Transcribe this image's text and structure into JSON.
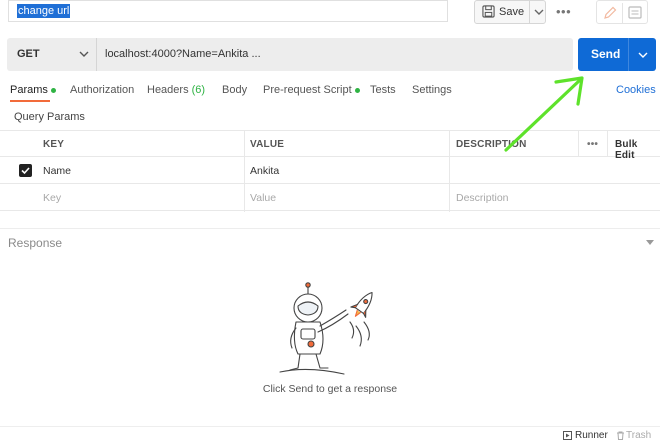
{
  "request": {
    "name": "change url",
    "save_label": "Save",
    "method": "GET",
    "url": "localhost:4000?Name=Ankita ...",
    "send_label": "Send"
  },
  "tabs": [
    {
      "label": "Params",
      "dot": true,
      "active": true
    },
    {
      "label": "Authorization"
    },
    {
      "label": "Headers",
      "count": "(6)"
    },
    {
      "label": "Body"
    },
    {
      "label": "Pre-request Script",
      "dot": true
    },
    {
      "label": "Tests"
    },
    {
      "label": "Settings"
    }
  ],
  "cookies_label": "Cookies",
  "query_params": {
    "title": "Query Params",
    "headers": {
      "key": "KEY",
      "value": "VALUE",
      "description": "DESCRIPTION",
      "more": "•••",
      "bulk_edit": "Bulk Edit"
    },
    "rows": [
      {
        "checked": true,
        "key": "Name",
        "value": "Ankita",
        "description": ""
      }
    ],
    "placeholder": {
      "key": "Key",
      "value": "Value",
      "description": "Description"
    }
  },
  "response": {
    "label": "Response",
    "empty_message": "Click Send to get a response"
  },
  "footer": {
    "runner_label": "Runner",
    "trash_label": "Trash"
  },
  "colors": {
    "send_button": "#0f6ad6",
    "link": "#1f6fd6",
    "active_tab_underline": "#f26b3a",
    "indicator_dot": "#2fb344",
    "annotation_arrow": "#5ee22b"
  },
  "icons": [
    "save-icon",
    "chevron-down-icon",
    "more-dots-icon",
    "edit-icon",
    "comment-icon",
    "checkbox-icon",
    "runner-icon",
    "trash-icon",
    "astronaut-illustration"
  ]
}
